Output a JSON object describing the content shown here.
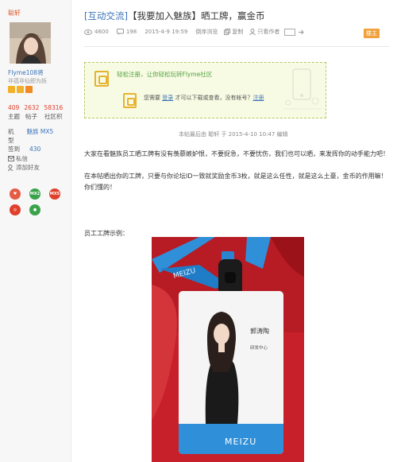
{
  "author": {
    "name": "聪轩",
    "title": "Flyme108将",
    "subtitle": "非孤非仙即为妖",
    "stats": [
      {
        "value": "409",
        "label": "主题"
      },
      {
        "value": "2632",
        "label": "帖子"
      },
      {
        "value": "58316",
        "label": "社区积"
      }
    ],
    "device_label": "机",
    "device_value": "魅族 MX5",
    "member_label": "型",
    "checkin_label": "签到",
    "checkin_value": "430",
    "message_label": "私信",
    "add_friend_label": "添加好友",
    "medals": [
      "MX2",
      "MX5"
    ]
  },
  "thread": {
    "category": "[互动交流]",
    "title": "【我要加入魅族】晒工牌，赢金币",
    "views": "4600",
    "replies": "198",
    "posted_time": "2015-4-9 19:59",
    "mode": "倒序浏览",
    "copy_label": "复制",
    "author_only_label": "只看作者",
    "floor_badge": "楼主"
  },
  "notice": {
    "register_text": "轻松注册，让你轻松玩转Flyme社区",
    "login_prefix": "您需要",
    "login_link": "登录",
    "login_middle": "才可以下载或查看，没有帐号？",
    "register_link": "注册"
  },
  "post": {
    "edit_note": "本帖最后由 聪轩 于 2015-4-10 10:47 编辑",
    "paragraph1": "大家在看魅族员工晒工牌有没有羡慕嫉妒恨，不要捉急，不要忧伤，我们也可以晒，来发挥你的动手能力吧！",
    "paragraph2": "在本帖晒出你的工牌，只要与你论坛ID一致就奖励金币3枚，就是这么任性，就是这么土豪，金币的作用嘛！你们懂的！",
    "example_label": "员工工牌示例："
  },
  "badge_card": {
    "brand": "MEIZU",
    "person_name": "郭涛陶",
    "department": "研发中心"
  },
  "colors": {
    "accent_blue": "#3b73b9",
    "accent_orange": "#e05a2b",
    "notice_green": "#4fa140"
  }
}
